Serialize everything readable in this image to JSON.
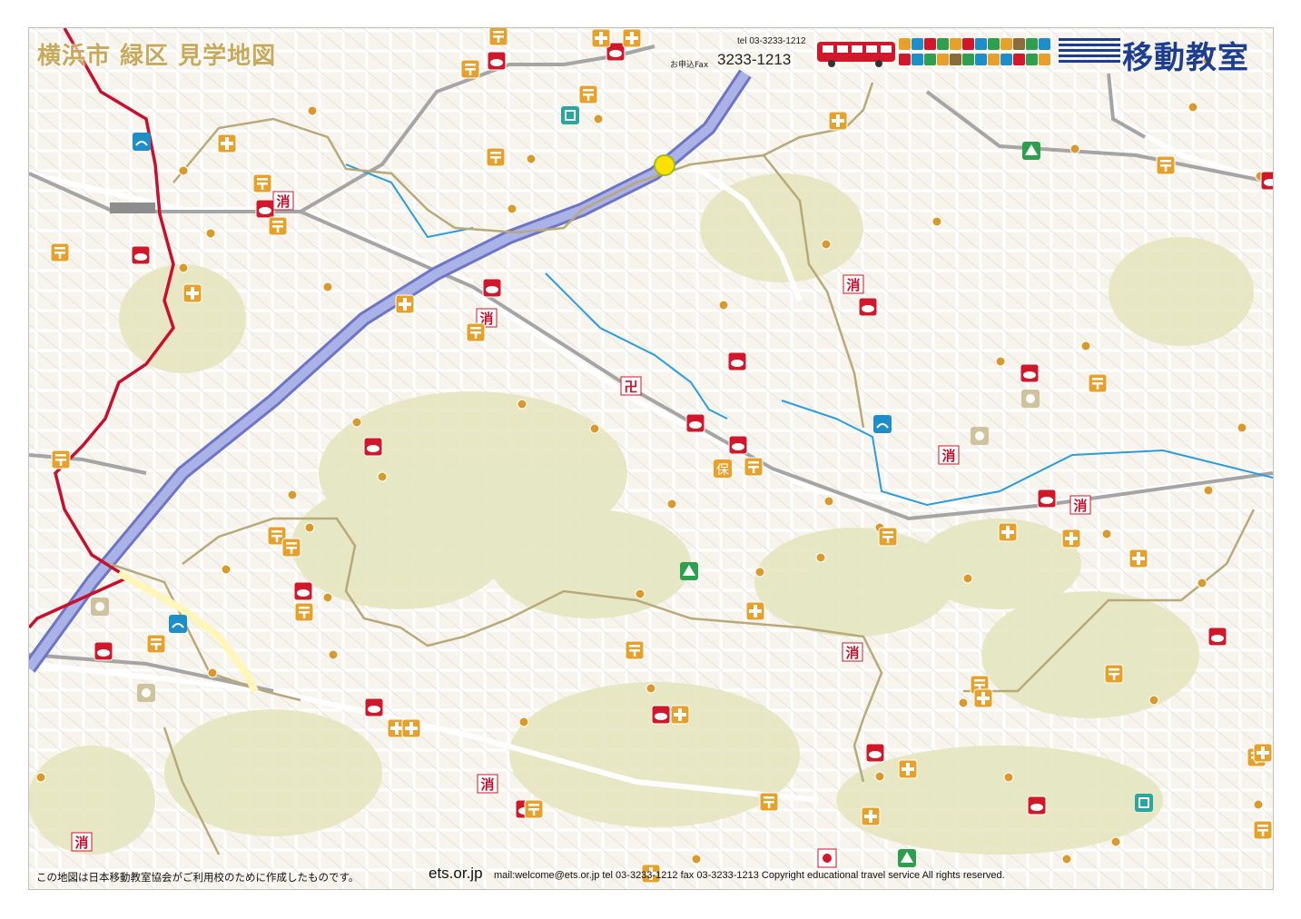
{
  "map": {
    "title": "横浜市 緑区 見学地図",
    "contact": {
      "tel": "tel 03-3233-1212",
      "fax_label": "お申込Fax",
      "fax_number": "3233-1213"
    },
    "brand": {
      "name": "移動教室",
      "accent_color": "#1d3d91",
      "bus_color": "#d0182a"
    },
    "legend_icon_colors": [
      "#e7a02a",
      "#1e8ec9",
      "#d0182a",
      "#2e9e4f",
      "#e7a02a",
      "#d0182a",
      "#1e8ec9",
      "#2e9e4f",
      "#e7a02a",
      "#8a6b3a",
      "#2e9e4f",
      "#1e8ec9"
    ],
    "symbols": {
      "fire_station": "消",
      "temple": "卍",
      "nursery": "保"
    },
    "colors": {
      "highway": "#8e98d6",
      "railway": "#c8102e",
      "river": "#2a9be0",
      "boundary": "#b9a979",
      "land": "#ece9cf",
      "road": "#ffffff",
      "marker": "#ffe000"
    },
    "footer": {
      "note": "この地図は日本移動教室協会がご利用校のために作成したものです。",
      "url": "ets.or.jp",
      "contact": "mail:welcome@ets.or.jp  tel 03-3233-1212  fax 03-3233-1213  Copyright educational travel service All rights reserved."
    }
  }
}
